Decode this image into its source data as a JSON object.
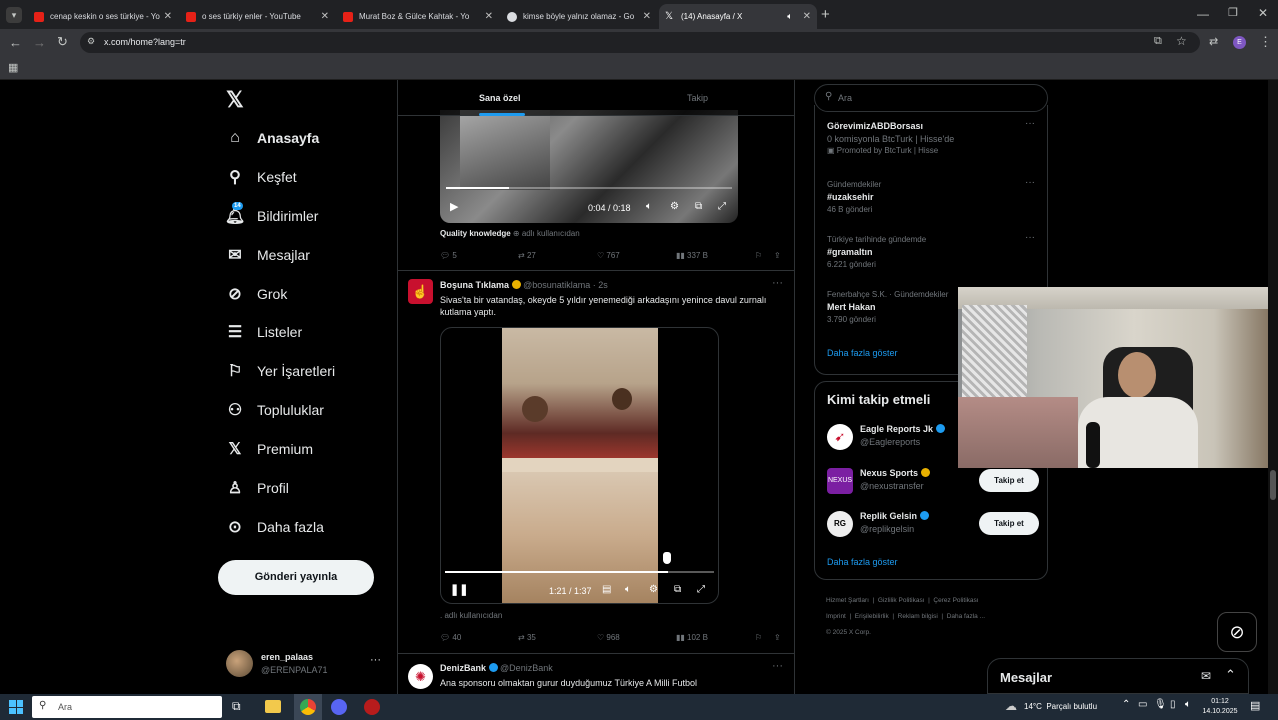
{
  "browser": {
    "tabs": [
      {
        "title": "cenap keskin o ses türkiye - Yo"
      },
      {
        "title": "o ses türkiy enler - YouTube"
      },
      {
        "title": "Murat Boz & Gülce Kahtak - Yo"
      },
      {
        "title": "kimse böyle yalnız olamaz - Go"
      },
      {
        "title": "(14) Anasayfa / X"
      }
    ],
    "url": "x.com/home?lang=tr"
  },
  "nav": {
    "logo": "X",
    "items": [
      {
        "label": "Anasayfa",
        "icon": "home-icon"
      },
      {
        "label": "Keşfet",
        "icon": "search-icon"
      },
      {
        "label": "Bildirimler",
        "icon": "bell-icon",
        "badge": "14"
      },
      {
        "label": "Mesajlar",
        "icon": "mail-icon"
      },
      {
        "label": "Grok",
        "icon": "grok-icon"
      },
      {
        "label": "Listeler",
        "icon": "list-icon"
      },
      {
        "label": "Yer İşaretleri",
        "icon": "bookmark-icon"
      },
      {
        "label": "Topluluklar",
        "icon": "people-icon"
      },
      {
        "label": "Premium",
        "icon": "x-icon"
      },
      {
        "label": "Profil",
        "icon": "person-icon"
      },
      {
        "label": "Daha fazla",
        "icon": "more-circle-icon"
      }
    ],
    "post_button": "Gönderi yayınla",
    "account": {
      "name": "eren_palaas",
      "handle": "@ERENPALA71"
    }
  },
  "timeline": {
    "tabs": [
      "Sana özel",
      "Takip"
    ],
    "tweet1": {
      "video_time": "0:04 / 0:18",
      "caption": "Quality knowledge",
      "caption_suffix": "adlı kullanıcıdan",
      "replies": "5",
      "reposts": "27",
      "likes": "767",
      "views": "337 B"
    },
    "tweet2": {
      "name": "Boşuna Tıklama",
      "handle": "@bosunatiklama",
      "time": "· 2s",
      "text": "Sivas'ta bir vatandaş, okeyde 5 yıldır yenemediği arkadaşını yenince davul zurnalı kutlama yaptı.",
      "video_time": "1:21 / 1:37",
      "caption_suffix": "adlı kullanıcıdan",
      "replies": "40",
      "reposts": "35",
      "likes": "968",
      "views": "102 B",
      "video_progress": 0.83
    },
    "tweet3": {
      "name": "DenizBank",
      "handle": "@DenizBank",
      "text": "Ana sponsoru olmaktan gurur duyduğumuz Türkiye A Milli Futbol"
    }
  },
  "right": {
    "search_placeholder": "Ara",
    "trends": [
      {
        "title": "GörevimizABDBorsası",
        "sub1": "0 komisyonla BtcTurk | Hisse'de",
        "sub2": "Promoted by BtcTurk | Hisse"
      },
      {
        "context": "Gündemdekiler",
        "title": "#uzaksehir",
        "count": "46 B gönderi"
      },
      {
        "context": "Türkiye tarihinde gündemde",
        "title": "#gramaltın",
        "count": "6.221 gönderi"
      },
      {
        "context": "Fenerbahçe S.K. · Gündemdekiler",
        "title": "Mert Hakan",
        "count": "3.790 gönderi"
      }
    ],
    "show_more": "Daha fazla göster",
    "who_to_follow_title": "Kimi takip etmeli",
    "follow": [
      {
        "name": "Eagle Reports Jk",
        "handle": "@Eaglereports"
      },
      {
        "name": "Nexus Sports",
        "handle": "@nexustransfer",
        "button": "Takip et"
      },
      {
        "name": "Replik Gelsin",
        "handle": "@replikgelsin",
        "button": "Takip et"
      }
    ],
    "show_more2": "Daha fazla göster",
    "footer": [
      "Hizmet Şartları",
      "Gizlilik Politikası",
      "Çerez Politikası",
      "Imprint",
      "Erişilebilirlik",
      "Reklam bilgisi",
      "Daha fazla ...",
      "© 2025 X Corp."
    ],
    "messages_label": "Mesajlar"
  },
  "taskbar": {
    "search_placeholder": "Ara",
    "weather": "14°C  Parçalı bulutlu",
    "time": "01:12",
    "date": "14.10.2025"
  }
}
